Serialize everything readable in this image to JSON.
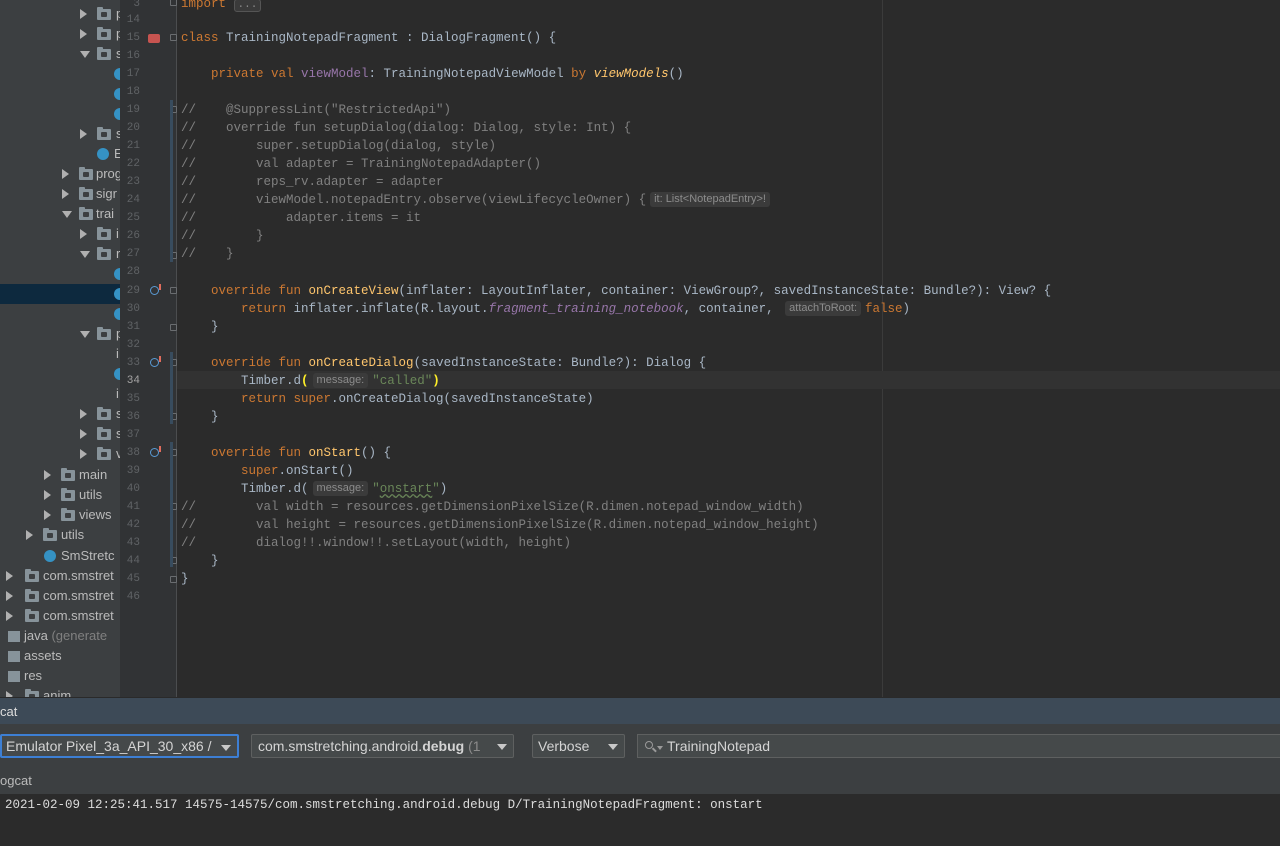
{
  "project_tree": {
    "rows": [
      {
        "label": "p",
        "gray": ""
      },
      {
        "label": "p",
        "gray": ""
      },
      {
        "label": "s",
        "gray": ""
      },
      {
        "label": "",
        "gray": ""
      },
      {
        "label": "",
        "gray": ""
      },
      {
        "label": "",
        "gray": ""
      },
      {
        "label": "s",
        "gray": ""
      },
      {
        "label": "E",
        "gray": ""
      },
      {
        "label": "prog",
        "gray": ""
      },
      {
        "label": "sigr",
        "gray": ""
      },
      {
        "label": "trai",
        "gray": ""
      },
      {
        "label": "i",
        "gray": ""
      },
      {
        "label": "r",
        "gray": ""
      },
      {
        "label": "",
        "gray": ""
      },
      {
        "label": "",
        "gray": ""
      },
      {
        "label": "",
        "gray": ""
      },
      {
        "label": "p",
        "gray": ""
      },
      {
        "label": "i",
        "gray": ""
      },
      {
        "label": "",
        "gray": ""
      },
      {
        "label": "i",
        "gray": ""
      },
      {
        "label": "s",
        "gray": ""
      },
      {
        "label": "s",
        "gray": ""
      },
      {
        "label": "v",
        "gray": ""
      },
      {
        "label": "main",
        "gray": ""
      },
      {
        "label": "utils",
        "gray": ""
      },
      {
        "label": "views",
        "gray": ""
      },
      {
        "label": "utils",
        "gray": ""
      },
      {
        "label": "SmStretc",
        "gray": ""
      },
      {
        "label": "com.smstret",
        "gray": ""
      },
      {
        "label": "com.smstret",
        "gray": ""
      },
      {
        "label": "com.smstret",
        "gray": ""
      },
      {
        "label": "java ",
        "gray": "(generate"
      },
      {
        "label": "assets",
        "gray": ""
      },
      {
        "label": "res",
        "gray": ""
      },
      {
        "label": "anim",
        "gray": ""
      }
    ]
  },
  "editor": {
    "line_numbers": [
      "3",
      "14",
      "15",
      "16",
      "17",
      "18",
      "19",
      "20",
      "21",
      "22",
      "23",
      "24",
      "25",
      "26",
      "27",
      "28",
      "29",
      "30",
      "31",
      "32",
      "33",
      "34",
      "35",
      "36",
      "37",
      "38",
      "39",
      "40",
      "41",
      "42",
      "43",
      "44",
      "45",
      "46"
    ],
    "current_line": "34",
    "fold_placeholder": "...",
    "code": {
      "l3": "import ",
      "l15_class": "class ",
      "l15_rest": "TrainingNotepadFragment : DialogFragment() {",
      "l17_kw": "    private val ",
      "l17_prop": "viewModel",
      "l17_mid": ": TrainingNotepadViewModel ",
      "l17_by": "by ",
      "l17_fn": "viewModels",
      "l17_end": "()",
      "l19": "//    @SuppressLint(\"RestrictedApi\")",
      "l20": "//    override fun setupDialog(dialog: Dialog, style: Int) {",
      "l21": "//        super.setupDialog(dialog, style)",
      "l22": "//        val adapter = TrainingNotepadAdapter()",
      "l23": "//        reps_rv.adapter = adapter",
      "l24": "//        viewModel.notepadEntry.observe(viewLifecycleOwner) {",
      "l24_hint": "it: List<NotepadEntry>!",
      "l25": "//            adapter.items = it",
      "l26": "//        }",
      "l27": "//    }",
      "l29_kw": "    override fun ",
      "l29_fn": "onCreateView",
      "l29_rest": "(inflater: LayoutInflater, container: ViewGroup?, savedInstanceState: Bundle?): View? {",
      "l30_kw": "        return ",
      "l30_a": "inflater.inflate(R.layout.",
      "l30_field": "fragment_training_notebook",
      "l30_b": ", container, ",
      "l30_hint": "attachToRoot:",
      "l30_false": "false",
      "l30_end": ")",
      "l31": "    }",
      "l33_kw": "    override fun ",
      "l33_fn": "onCreateDialog",
      "l33_rest": "(savedInstanceState: Bundle?): Dialog {",
      "l34_a": "        Timber.d",
      "l34_paren": "(",
      "l34_hint": "message:",
      "l34_str": "\"called\"",
      "l34_close": ")",
      "l35_kw": "        return super",
      "l35_rest": ".onCreateDialog(savedInstanceState)",
      "l36": "    }",
      "l38_kw": "    override fun ",
      "l38_fn": "onStart",
      "l38_rest": "() {",
      "l39_kw": "        super",
      "l39_rest": ".onStart()",
      "l40_a": "        Timber.d(",
      "l40_hint": "message:",
      "l40_str_q1": "\"",
      "l40_str_word": "onstart",
      "l40_str_q2": "\"",
      "l40_end": ")",
      "l41": "//        val width = resources.getDimensionPixelSize(R.dimen.notepad_window_width)",
      "l42": "//        val height = resources.getDimensionPixelSize(R.dimen.notepad_window_height)",
      "l43": "//        dialog!!.window!!.setLayout(width, height)",
      "l44": "    }",
      "l45": "}"
    }
  },
  "logcat": {
    "title": "cat",
    "device_selector": "Emulator Pixel_3a_API_30_x86 /",
    "process_prefix": "com.smstretching.android.",
    "process_bold": "debug",
    "process_suffix": " (1",
    "level_selector": "Verbose",
    "search_value": "TrainingNotepad",
    "subheader": "ogcat",
    "log_line": "2021-02-09 12:25:41.517 14575-14575/com.smstretching.android.debug D/TrainingNotepadFragment: onstart"
  },
  "colors": {
    "background": "#2b2b2b",
    "keyword": "#cc7832",
    "function": "#ffc66d",
    "string": "#6a8759",
    "comment": "#808080",
    "property": "#9876aa",
    "focus_border": "#3d7fd4",
    "selection": "#0d293e"
  }
}
